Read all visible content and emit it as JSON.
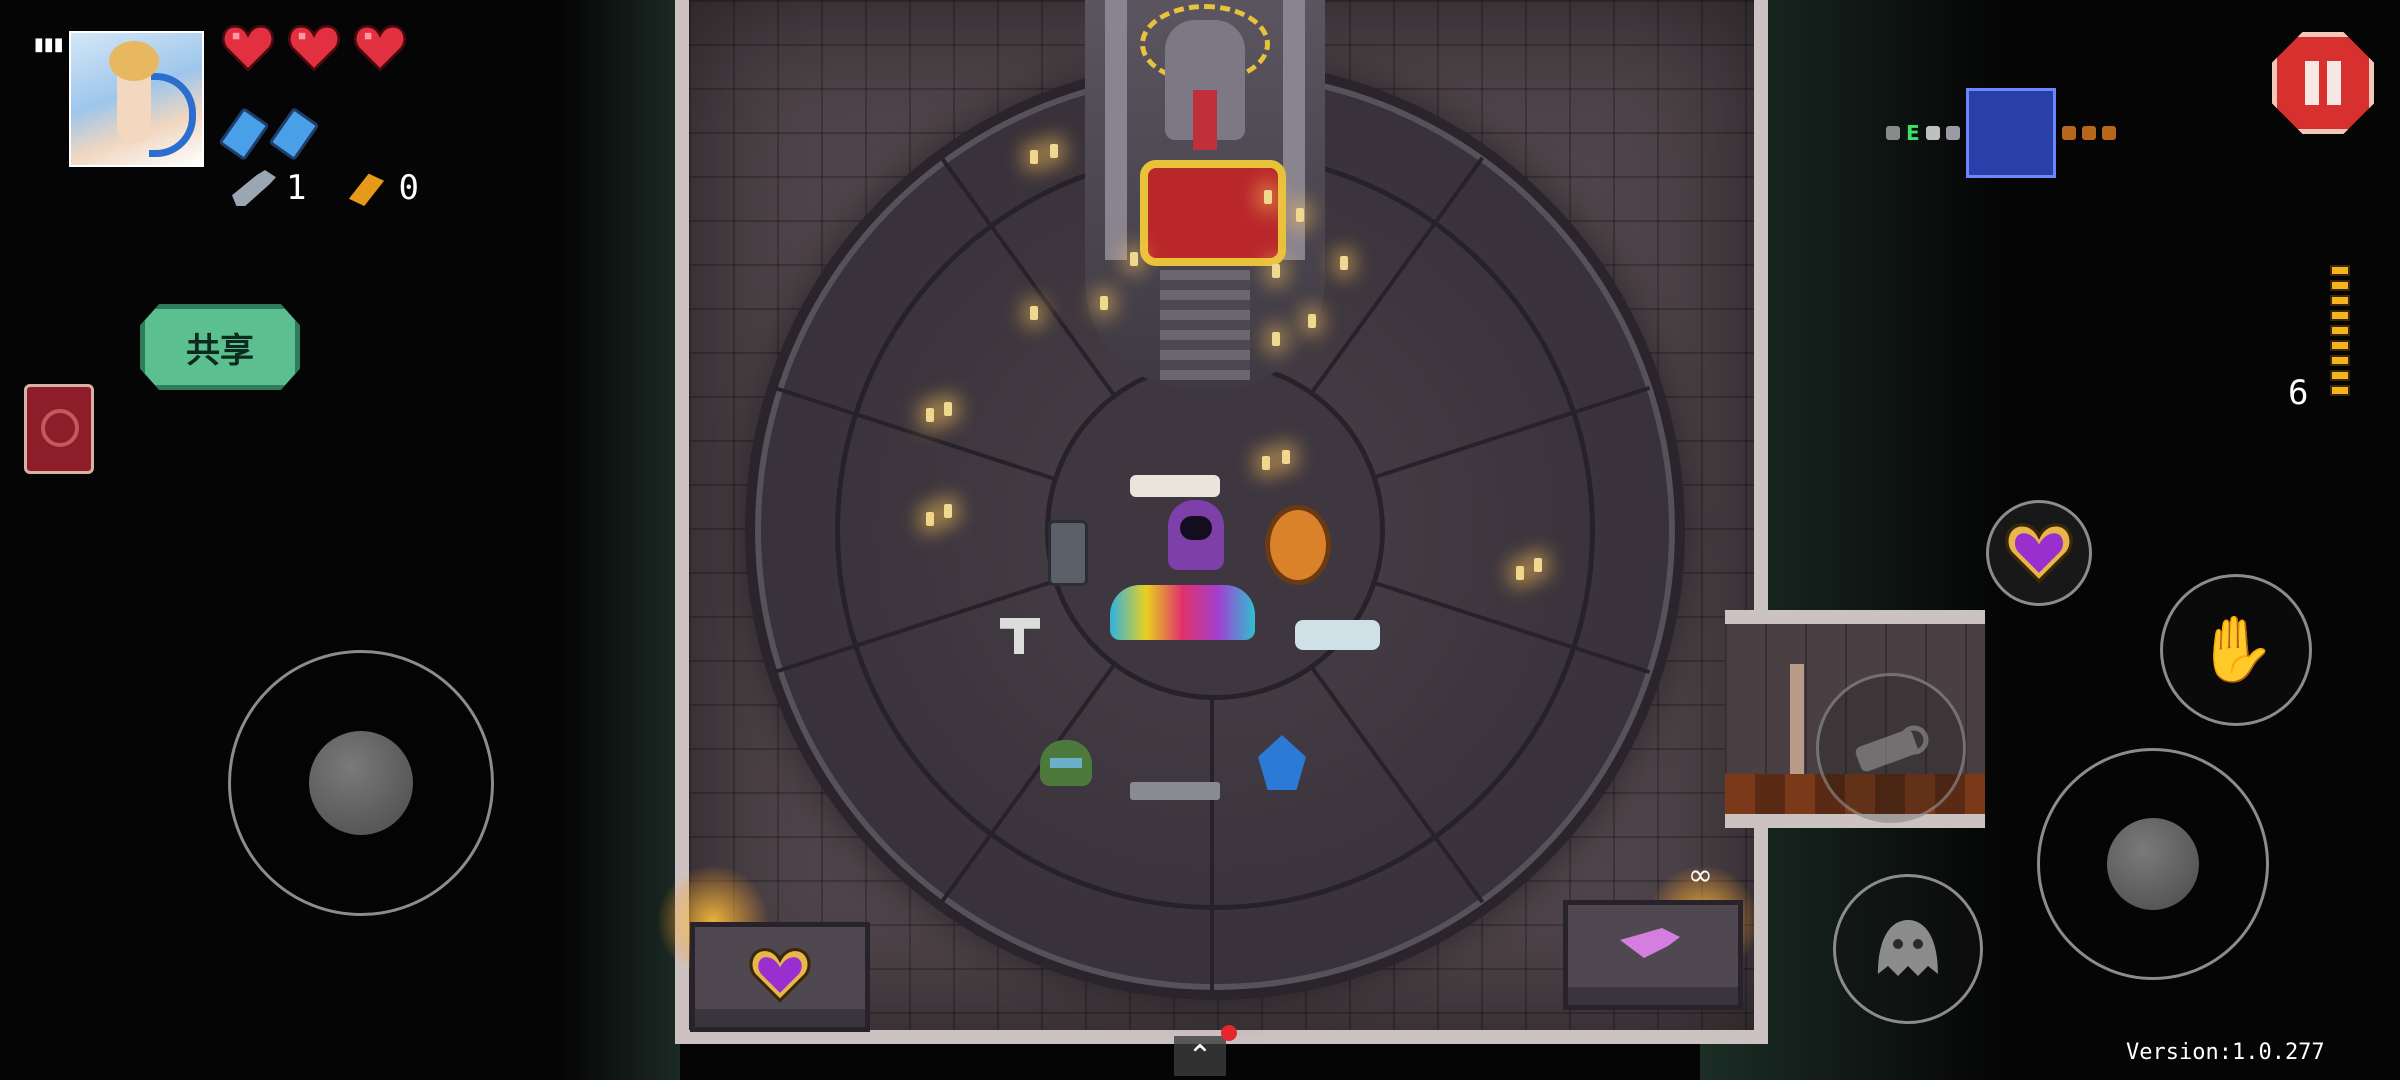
{
  "hud": {
    "health_hearts": 3,
    "energy_count": 2,
    "keys_count": "1",
    "shells_count": "0",
    "share_label": "共享",
    "ammo_count": "6",
    "version_text": "Version:1.0.277",
    "infinity_symbol": "∞"
  },
  "icons": {
    "signal": "signal-icon",
    "avatar": "player-avatar",
    "heart": "heart-icon",
    "energy": "energy-icon",
    "key": "key-icon",
    "shell": "shell-icon",
    "book": "book-icon",
    "pause": "pause-icon",
    "hand": "hand-icon",
    "ghost": "ghost-icon",
    "up_arrow": "chevron-up-icon"
  },
  "colors": {
    "heart": "#e23040",
    "energy": "#4aa0e8",
    "share_button": "#5bbf90",
    "pause_button": "#d8302e",
    "minimap_current_room": "#2b3fa8",
    "ammo": "#f5b31e"
  },
  "game": {
    "ammo_bar_segments": 9
  }
}
